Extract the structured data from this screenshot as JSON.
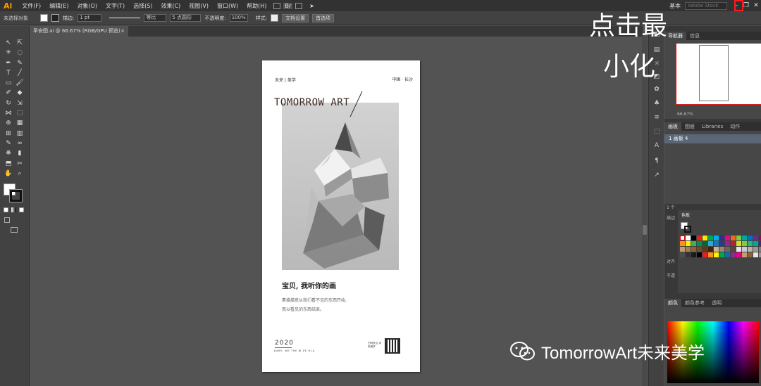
{
  "app": {
    "logo": "Ai",
    "menu": [
      "文件(F)",
      "编辑(E)",
      "对象(O)",
      "文字(T)",
      "选择(S)",
      "效果(C)",
      "视图(V)",
      "窗口(W)",
      "帮助(H)"
    ],
    "workspace": "基本",
    "stock_search_placeholder": "Adobe Stock",
    "br_label": "Br"
  },
  "control_bar": {
    "selection_status": "未选择对象",
    "stroke_label": "描边:",
    "stroke_width": "1 pt",
    "stroke_profile": "等比",
    "brush": "5 点圆形",
    "opacity_label": "不透明度:",
    "opacity": "100%",
    "style_label": "样式:",
    "doc_setup": "文档设置",
    "preferences": "首选项"
  },
  "document": {
    "tab_title": "早安图.ai @ 66.67% (RGB/GPU 预览)",
    "close": "×"
  },
  "artboard": {
    "brand": "未来 | 美学",
    "location": "中国 · 长沙",
    "title": "TOMORROW ART",
    "headline": "宝贝, 我听你的画",
    "line1": "素描描意从我们看不见的东西开始,",
    "line2": "而以看见的东西结束。",
    "year": "2020",
    "small": "BABY, WE THE W DE HLA",
    "qr_text": "扫码关注·未来美学"
  },
  "overlay": {
    "minimize_line1": "点击最",
    "minimize_line2": "小化",
    "watermark": "TomorrowArt未来美学"
  },
  "panels": {
    "top_tabs": [
      "导航器",
      "信息"
    ],
    "zoom": "66.67%",
    "artboard_tabs": [
      "画板",
      "图层",
      "Libraries",
      "动作"
    ],
    "artboard_row": "1    画板 4",
    "color_tabs": [
      "颜色",
      "颜色参考",
      "透明"
    ],
    "swatch_title": "色板",
    "side_labels": [
      "1 个",
      "描边",
      "对齐",
      "不透"
    ]
  },
  "colors": {
    "accent": "#ff9a00",
    "highlight": "#ff1a1a",
    "selected_row": "#5a6675"
  }
}
